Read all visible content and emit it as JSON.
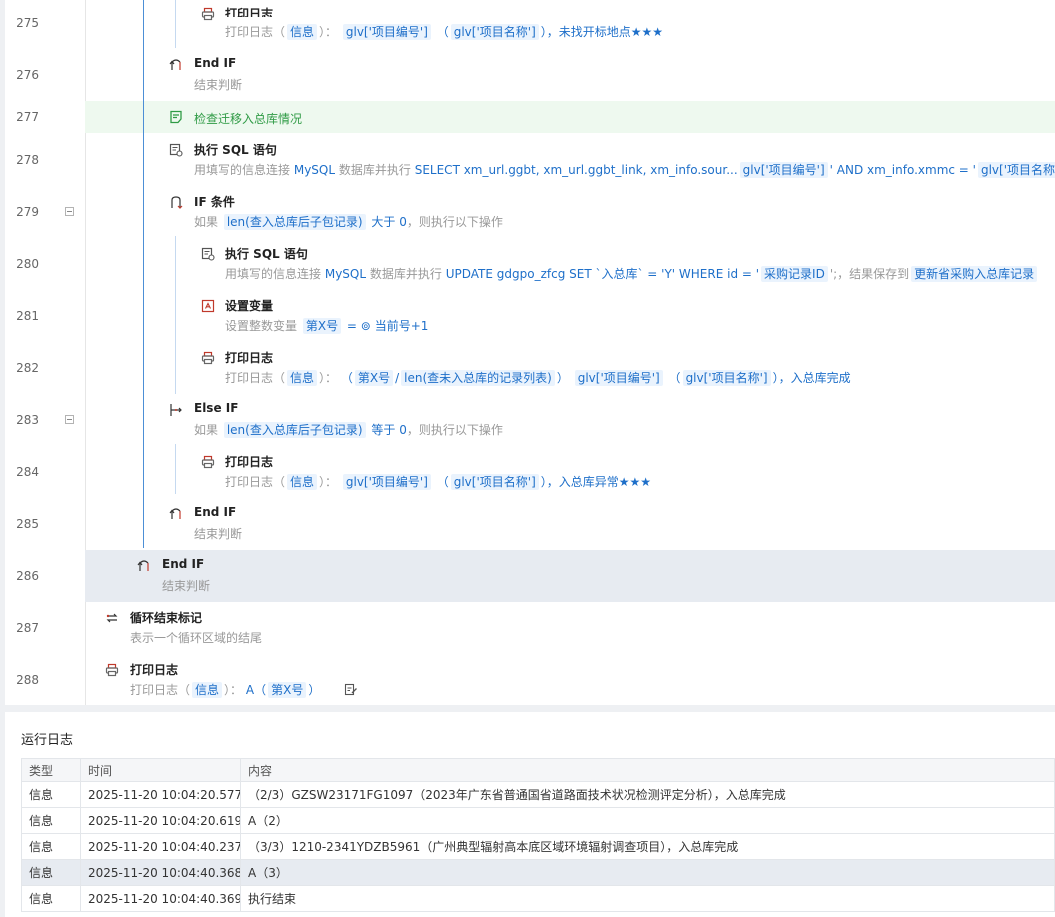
{
  "editor": {
    "rows": [
      {
        "line": "275",
        "title": "打印日志",
        "sub_prefix": "打印日志（",
        "t1": "信息",
        "mid": "）：",
        "t2": "glv['项目编号']",
        "t3": "（",
        "t4": "glv['项目名称']",
        "t5": "），未找开标地点★★★"
      },
      {
        "line": "276",
        "title": "End IF",
        "sub": "结束判断"
      },
      {
        "line": "277",
        "title": "检查迁移入总库情况"
      },
      {
        "line": "278",
        "title": "执行 SQL 语句",
        "sub_prefix": "用填写的信息连接",
        "db": "MySQL",
        "mid": "数据库并执行",
        "sql": "SELECT xm_url.ggbt, xm_url.ggbt_link, xm_info.sour...",
        "t1": "glv['项目编号']",
        "s2": "' AND xm_info.xmmc = '",
        "t2": "glv['项目名称']",
        "s3": "'"
      },
      {
        "line": "279",
        "title": "IF 条件",
        "sub_prefix": "如果",
        "t1": "len(查入总库后子包记录)",
        "mid": "大于",
        "num": "0",
        "suffix": "，则执行以下操作"
      },
      {
        "line": "280",
        "title": "执行 SQL 语句",
        "sub_prefix": "用填写的信息连接",
        "db": "MySQL",
        "mid": "数据库并执行",
        "sql": "UPDATE gdgpo_zfcg SET `入总库` = 'Y' WHERE id = '",
        "t1": "采购记录ID",
        "s2": "';，结果保存到",
        "t2": "更新省采购入总库记录"
      },
      {
        "line": "281",
        "title": "设置变量",
        "sub_prefix": "设置整数变量",
        "t1": "第X号",
        "mid": "=",
        "val": "当前号+1"
      },
      {
        "line": "282",
        "title": "打印日志",
        "sub_prefix": "打印日志（",
        "t1": "信息",
        "mid": "）：",
        "p1": "（",
        "t2": "第X号",
        "slash": "/",
        "t3": "len(查未入总库的记录列表)",
        "p2": "）",
        "t4": "glv['项目编号']",
        "p3": "（",
        "t5": "glv['项目名称']",
        "p4": "），入总库完成"
      },
      {
        "line": "283",
        "title": "Else IF",
        "sub_prefix": "如果",
        "t1": "len(查入总库后子包记录)",
        "mid": "等于",
        "num": "0",
        "suffix": "，则执行以下操作"
      },
      {
        "line": "284",
        "title": "打印日志",
        "sub_prefix": "打印日志（",
        "t1": "信息",
        "mid": "）：",
        "t2": "glv['项目编号']",
        "t3": "（",
        "t4": "glv['项目名称']",
        "t5": "），入总库异常★★★"
      },
      {
        "line": "285",
        "title": "End IF",
        "sub": "结束判断"
      },
      {
        "line": "286",
        "title": "End IF",
        "sub": "结束判断"
      },
      {
        "line": "287",
        "title": "循环结束标记",
        "sub": "表示一个循环区域的结尾"
      },
      {
        "line": "288",
        "title": "打印日志",
        "sub_prefix": "打印日志（",
        "t1": "信息",
        "mid": "）：",
        "a": "A（",
        "t2": "第X号",
        "a2": "）"
      }
    ]
  },
  "log": {
    "title": "运行日志",
    "headers": [
      "类型",
      "时间",
      "内容"
    ],
    "rows": [
      {
        "type": "信息",
        "time": "2025-11-20 10:04:20.577",
        "content": "（2/3）GZSW23171FG1097（2023年广东省普通国省道路面技术状况检测评定分析），入总库完成"
      },
      {
        "type": "信息",
        "time": "2025-11-20 10:04:20.619",
        "content": "A（2）"
      },
      {
        "type": "信息",
        "time": "2025-11-20 10:04:40.237",
        "content": "（3/3）1210-2341YDZB5961（广州典型辐射高本底区域环境辐射调查项目），入总库完成"
      },
      {
        "type": "信息",
        "time": "2025-11-20 10:04:40.368",
        "content": "A（3）"
      },
      {
        "type": "信息",
        "time": "2025-11-20 10:04:40.369",
        "content": "执行结束"
      }
    ]
  },
  "colors": {
    "accent": "#1e6fc9",
    "guide": "#4c8fd6",
    "selected_row": "#e7ebf1",
    "highlight_row": "#eef9ef"
  }
}
